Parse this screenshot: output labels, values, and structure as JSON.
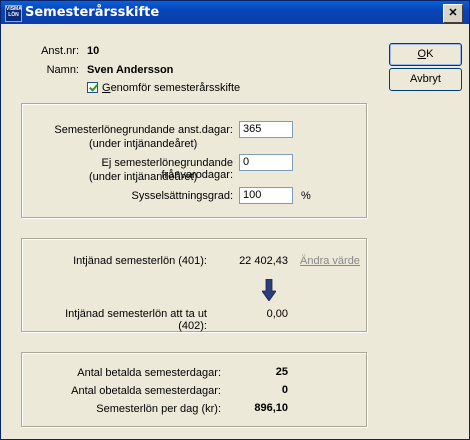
{
  "window": {
    "title": "Semesterårsskifte",
    "app_icon_text": "Visma Lön"
  },
  "employee": {
    "anst_nr_label": "Anst.nr:",
    "anst_nr_value": "10",
    "namn_label": "Namn:",
    "namn_value": "Sven Andersson"
  },
  "checkbox": {
    "label": "Genomför semesterårsskifte",
    "checked": true
  },
  "buttons": {
    "ok": "OK",
    "cancel": "Avbryt"
  },
  "panel1": {
    "field1_label_line1": "Semesterlönegrundande anst.dagar:",
    "field1_label_line2": "(under intjänandeåret)",
    "field1_value": "365",
    "field2_label_line1": "Ej semesterlönegrundande frånvarodagar:",
    "field2_label_line2": "(under intjänandeåret)",
    "field2_value": "0",
    "field3_label": "Sysselsättningsgrad:",
    "field3_value": "100",
    "field3_unit": "%"
  },
  "panel2": {
    "intjanad_label": "Intjänad semesterlön (401):",
    "intjanad_value": "22 402,43",
    "andra_link": "Ändra värde",
    "arrow_icon": "arrow-down-icon",
    "att_ta_ut_label": "Intjänad semesterlön att ta ut (402):",
    "att_ta_ut_value": "0,00"
  },
  "panel3": {
    "betalda_label": "Antal betalda semesterdagar:",
    "betalda_value": "25",
    "obetalda_label": "Antal obetalda semesterdagar:",
    "obetalda_value": "0",
    "per_dag_label": "Semesterlön per dag (kr):",
    "per_dag_value": "896,10"
  },
  "colors": {
    "titlebar": "#0a4fc8",
    "dialog_bg": "#ece9d8",
    "arrow": "#2a3f7a"
  }
}
